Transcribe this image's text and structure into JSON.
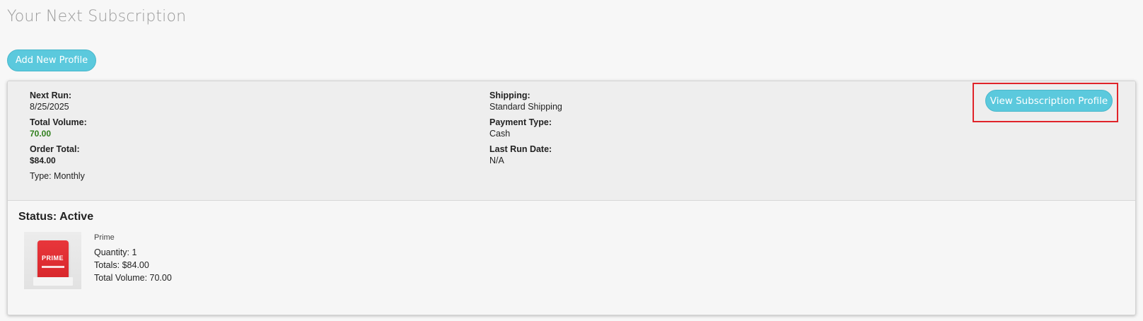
{
  "page": {
    "title": "Your Next Subscription"
  },
  "actions": {
    "add_profile_label": "Add New Profile",
    "view_profile_label": "View Subscription Profile"
  },
  "subscription": {
    "next_run_label": "Next Run:",
    "next_run_value": "8/25/2025",
    "total_volume_label": "Total Volume:",
    "total_volume_value": "70.00",
    "order_total_label": "Order Total:",
    "order_total_value": "$84.00",
    "type_line": "Type: Monthly",
    "shipping_label": "Shipping:",
    "shipping_value": "Standard Shipping",
    "payment_type_label": "Payment Type:",
    "payment_type_value": "Cash",
    "last_run_label": "Last Run Date:",
    "last_run_value": "N/A",
    "status": "Status: Active"
  },
  "product": {
    "image_brand": "PRIME",
    "name": "Prime",
    "quantity": "Quantity: 1",
    "totals": "Totals: $84.00",
    "total_volume": "Total Volume: 70.00"
  },
  "colors": {
    "accent": "#5bc9dd",
    "highlight": "#e0242a",
    "volume_green": "#2f7f1c"
  }
}
